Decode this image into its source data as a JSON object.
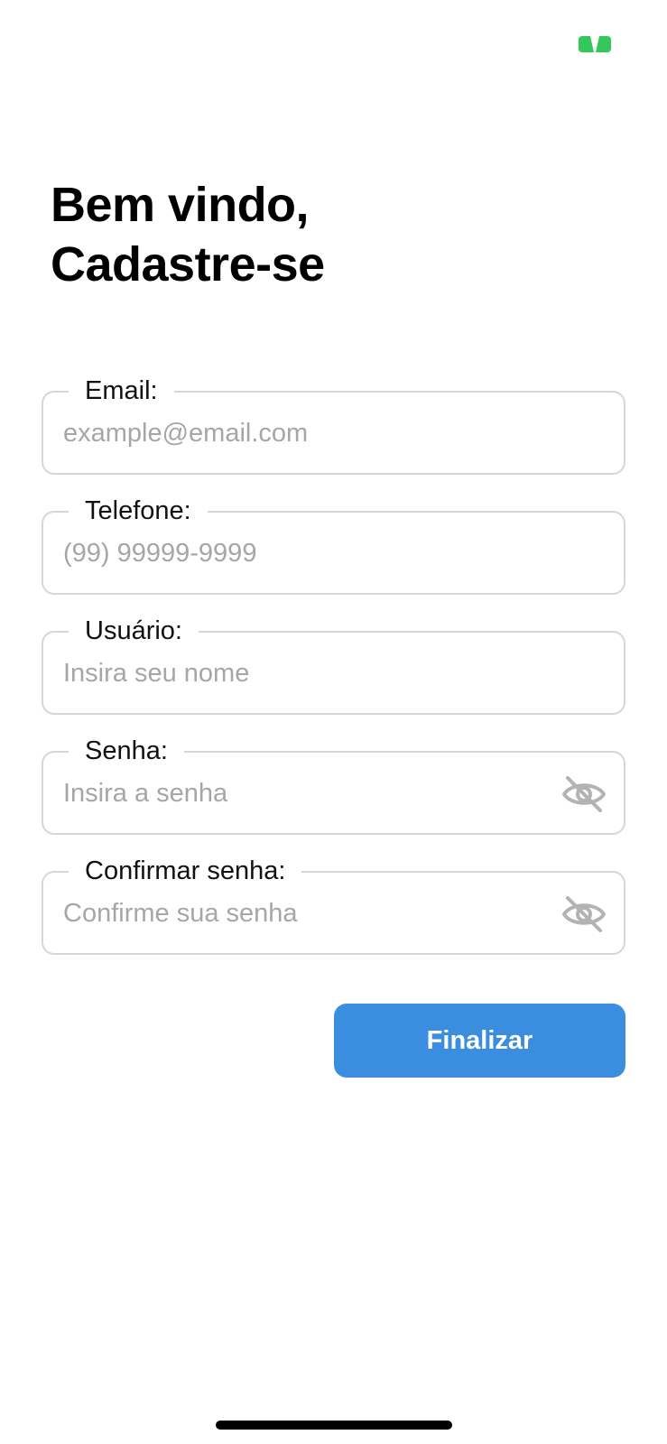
{
  "colors": {
    "accent": "#3b8ddf",
    "status_indicator": "#34c759",
    "field_border": "#d6d6d6",
    "placeholder": "#a6a6a6",
    "icon": "#b3b3b3"
  },
  "status_bar": {
    "indicator_icon": "camera-active-indicator-icon"
  },
  "heading": {
    "line1": "Bem vindo,",
    "line2": "Cadastre-se"
  },
  "form": {
    "fields": [
      {
        "label": "Email:",
        "placeholder": "example@email.com",
        "value": ""
      },
      {
        "label": "Telefone:",
        "placeholder": "(99) 99999-9999",
        "value": ""
      },
      {
        "label": "Usuário:",
        "placeholder": "Insira seu nome",
        "value": ""
      },
      {
        "label": "Senha:",
        "placeholder": "Insira a senha",
        "value": "",
        "icon": "eye-off-icon"
      },
      {
        "label": "Confirmar senha:",
        "placeholder": "Confirme sua senha",
        "value": "",
        "icon": "eye-off-icon"
      }
    ],
    "submit_label": "Finalizar"
  }
}
